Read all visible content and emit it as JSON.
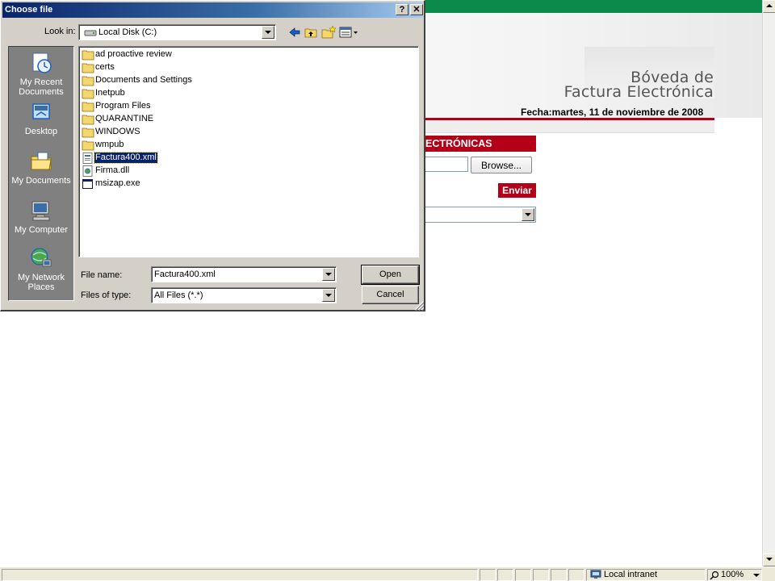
{
  "background_page": {
    "logo_line1": "Bóveda de",
    "logo_line2": "Factura Electrónica",
    "fecha": "Fecha:martes, 11 de noviembre de 2008",
    "section_title": "ECTRÓNICAS",
    "browse_label": "Browse...",
    "enviar_label": "Enviar",
    "brand_colors": {
      "green": "#0b8a4b",
      "red": "#b30018"
    }
  },
  "dialog": {
    "title": "Choose file",
    "help_label": "?",
    "close_label": "✕",
    "look_in_label": "Look in:",
    "look_in_value": "Local Disk (C:)",
    "toolbar_icons": [
      "back-icon",
      "up-folder-icon",
      "new-folder-icon",
      "view-menu-icon"
    ],
    "places": [
      {
        "label_line1": "My Recent",
        "label_line2": "Documents",
        "icon": "recent-documents-icon"
      },
      {
        "label_line1": "Desktop",
        "label_line2": "",
        "icon": "desktop-icon"
      },
      {
        "label_line1": "My Documents",
        "label_line2": "",
        "icon": "my-documents-icon"
      },
      {
        "label_line1": "My Computer",
        "label_line2": "",
        "icon": "my-computer-icon"
      },
      {
        "label_line1": "My Network",
        "label_line2": "Places",
        "icon": "network-places-icon"
      }
    ],
    "files": [
      {
        "name": "ad proactive review",
        "type": "folder"
      },
      {
        "name": "certs",
        "type": "folder"
      },
      {
        "name": "Documents and Settings",
        "type": "folder"
      },
      {
        "name": "Inetpub",
        "type": "folder"
      },
      {
        "name": "Program Files",
        "type": "folder"
      },
      {
        "name": "QUARANTINE",
        "type": "folder"
      },
      {
        "name": "WINDOWS",
        "type": "folder"
      },
      {
        "name": "wmpub",
        "type": "folder"
      },
      {
        "name": "Factura400.xml",
        "type": "xml",
        "selected": true
      },
      {
        "name": "Firma.dll",
        "type": "dll"
      },
      {
        "name": "msizap.exe",
        "type": "exe"
      }
    ],
    "file_name_label": "File name:",
    "file_name_value": "Factura400.xml",
    "files_of_type_label": "Files of type:",
    "files_of_type_value": "All Files (*.*)",
    "open_label": "Open",
    "cancel_label": "Cancel"
  },
  "status_bar": {
    "zone": "Local intranet",
    "zoom": "100%"
  }
}
